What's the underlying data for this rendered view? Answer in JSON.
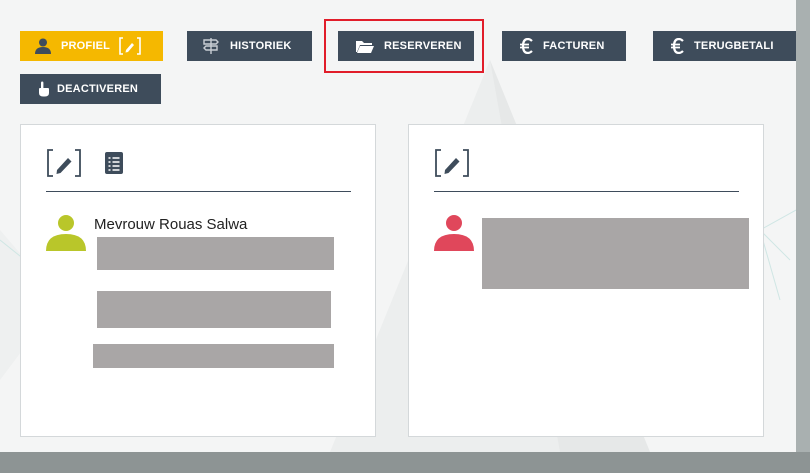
{
  "tabs": [
    {
      "label": "PROFIEL",
      "icon": "user-icon",
      "active": true
    },
    {
      "label": "HISTORIEK",
      "icon": "signpost-icon",
      "active": false
    },
    {
      "label": "RESERVEREN",
      "icon": "folder-open-icon",
      "active": false
    },
    {
      "label": "FACTUREN",
      "icon": "euro-icon",
      "active": false
    },
    {
      "label": "TERUGBETALI",
      "icon": "euro-icon",
      "active": false
    },
    {
      "label": "DEACTIVEREN",
      "icon": "pointer-hand-icon",
      "active": false
    }
  ],
  "left_card": {
    "tools": [
      "edit-icon",
      "list-icon"
    ],
    "person_name": "Mevrouw Rouas Salwa",
    "avatar_color": "#b9c62a"
  },
  "right_card": {
    "tools": [
      "edit-icon"
    ],
    "avatar_color": "#e0475b"
  },
  "colors": {
    "accent": "#f5b800",
    "tab_bg": "#3e4c5b",
    "highlight": "#e11d2a"
  }
}
